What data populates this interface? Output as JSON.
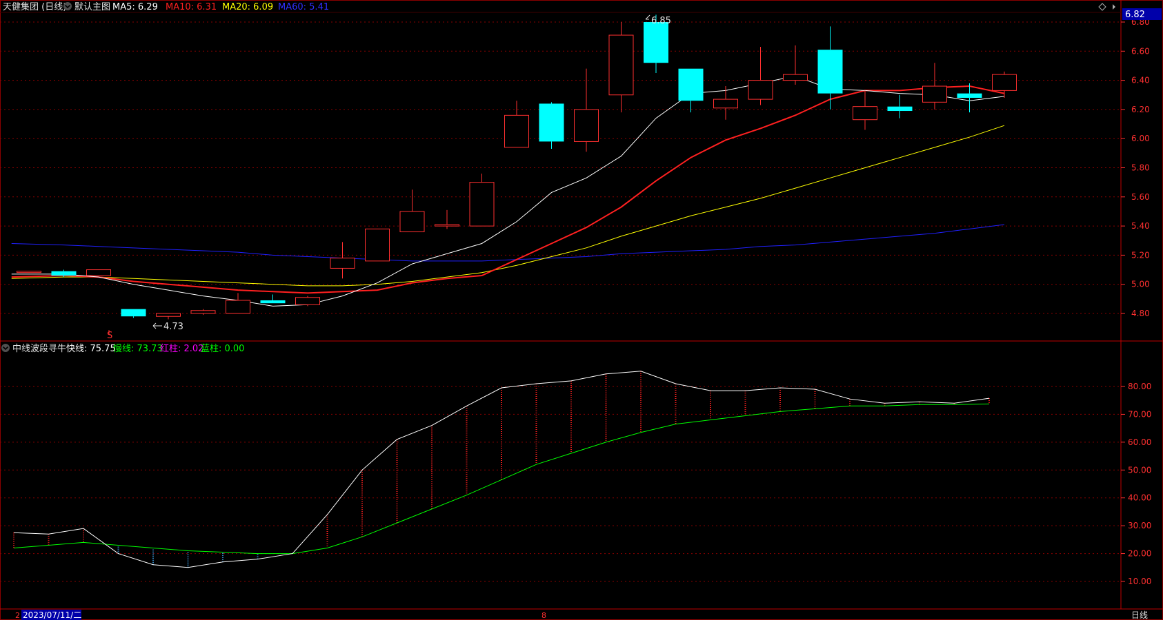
{
  "header": {
    "stock_name": "天健集团 (日线)",
    "main_chart_label": "默认主图",
    "ma_labels": [
      {
        "text": "MA5: 6.29",
        "color": "#ffffff"
      },
      {
        "text": "MA10: 6.31",
        "color": "#ff2020"
      },
      {
        "text": "MA20: 6.09",
        "color": "#ffff00"
      },
      {
        "text": "MA60: 5.41",
        "color": "#2020ff"
      }
    ],
    "current_price_badge": "6.82"
  },
  "indicator_header": {
    "name": "中线波段寻牛",
    "items": [
      {
        "text": "快线: 75.75",
        "color": "#ffffff"
      },
      {
        "text": "慢线: 73.73",
        "color": "#00ff00"
      },
      {
        "text": "红柱: 2.02",
        "color": "#ff00ff"
      },
      {
        "text": "蓝柱: 0.00",
        "color": "#00ff00"
      }
    ]
  },
  "price_axis_ticks": [
    "6.80",
    "6.60",
    "6.40",
    "6.20",
    "6.00",
    "5.80",
    "5.60",
    "5.40",
    "5.20",
    "5.00",
    "4.80"
  ],
  "indicator_axis_ticks": [
    "80.00",
    "70.00",
    "60.00",
    "50.00",
    "40.00",
    "30.00",
    "20.00",
    "10.00"
  ],
  "annotations": {
    "high_label": "6.85",
    "low_label": "4.73",
    "signal_marker": "S"
  },
  "footer": {
    "date": "2023/07/11/二",
    "left_marker": "2",
    "month_marker": "8",
    "period_button": "日线"
  },
  "colors": {
    "up": "#ff3030",
    "down": "#00ffff",
    "ma5": "#ffffff",
    "ma10": "#ff2020",
    "ma20": "#ffff00",
    "ma60": "#2020ff",
    "grid": "#8b0000",
    "axis_text": "#ff3030",
    "fast": "#ffffff",
    "slow": "#00ff00"
  },
  "chart_data": [
    {
      "type": "candlestick",
      "title": "",
      "ylim": [
        4.7,
        6.86
      ],
      "candles": [
        {
          "o": 5.09,
          "h": 5.09,
          "l": 5.09,
          "c": 5.09
        },
        {
          "o": 5.09,
          "h": 5.1,
          "l": 5.05,
          "c": 5.06
        },
        {
          "o": 5.06,
          "h": 5.1,
          "l": 5.06,
          "c": 5.1
        },
        {
          "o": 4.83,
          "h": 4.83,
          "l": 4.77,
          "c": 4.78
        },
        {
          "o": 4.78,
          "h": 4.8,
          "l": 4.76,
          "c": 4.8
        },
        {
          "o": 4.8,
          "h": 4.83,
          "l": 4.79,
          "c": 4.82
        },
        {
          "o": 4.8,
          "h": 4.94,
          "l": 4.8,
          "c": 4.89
        },
        {
          "o": 4.89,
          "h": 4.93,
          "l": 4.87,
          "c": 4.87
        },
        {
          "o": 4.86,
          "h": 4.92,
          "l": 4.85,
          "c": 4.91
        },
        {
          "o": 5.11,
          "h": 5.29,
          "l": 5.04,
          "c": 5.18
        },
        {
          "o": 5.16,
          "h": 5.38,
          "l": 5.16,
          "c": 5.38
        },
        {
          "o": 5.36,
          "h": 5.65,
          "l": 5.36,
          "c": 5.5
        },
        {
          "o": 5.4,
          "h": 5.51,
          "l": 5.38,
          "c": 5.41
        },
        {
          "o": 5.4,
          "h": 5.76,
          "l": 5.4,
          "c": 5.7
        },
        {
          "o": 5.94,
          "h": 6.26,
          "l": 5.94,
          "c": 6.16
        },
        {
          "o": 6.24,
          "h": 6.25,
          "l": 5.93,
          "c": 5.98
        },
        {
          "o": 5.98,
          "h": 6.48,
          "l": 5.91,
          "c": 6.2
        },
        {
          "o": 6.3,
          "h": 6.8,
          "l": 6.18,
          "c": 6.71
        },
        {
          "o": 6.8,
          "h": 6.85,
          "l": 6.45,
          "c": 6.52
        },
        {
          "o": 6.48,
          "h": 6.48,
          "l": 6.18,
          "c": 6.26
        },
        {
          "o": 6.21,
          "h": 6.36,
          "l": 6.13,
          "c": 6.27
        },
        {
          "o": 6.27,
          "h": 6.63,
          "l": 6.23,
          "c": 6.4
        },
        {
          "o": 6.4,
          "h": 6.64,
          "l": 6.37,
          "c": 6.44
        },
        {
          "o": 6.61,
          "h": 6.77,
          "l": 6.2,
          "c": 6.31
        },
        {
          "o": 6.13,
          "h": 6.33,
          "l": 6.06,
          "c": 6.22
        },
        {
          "o": 6.22,
          "h": 6.3,
          "l": 6.14,
          "c": 6.19
        },
        {
          "o": 6.25,
          "h": 6.52,
          "l": 6.2,
          "c": 6.36
        },
        {
          "o": 6.31,
          "h": 6.38,
          "l": 6.18,
          "c": 6.28
        },
        {
          "o": 6.33,
          "h": 6.46,
          "l": 6.28,
          "c": 6.44
        }
      ],
      "ma5": [
        5.07,
        5.07,
        5.05,
        5.0,
        4.96,
        4.92,
        4.89,
        4.85,
        4.86,
        4.92,
        5.01,
        5.14,
        5.21,
        5.28,
        5.43,
        5.63,
        5.73,
        5.88,
        6.14,
        6.31,
        6.33,
        6.38,
        6.43,
        6.34,
        6.33,
        6.31,
        6.3,
        6.26,
        6.29
      ],
      "ma10": [
        5.05,
        5.06,
        5.05,
        5.02,
        5.0,
        4.98,
        4.96,
        4.95,
        4.94,
        4.95,
        4.96,
        5.01,
        5.04,
        5.06,
        5.17,
        5.28,
        5.39,
        5.53,
        5.71,
        5.87,
        5.99,
        6.07,
        6.16,
        6.27,
        6.33,
        6.33,
        6.35,
        6.36,
        6.31
      ],
      "ma20": [
        5.04,
        5.05,
        5.05,
        5.04,
        5.03,
        5.02,
        5.01,
        5.0,
        4.99,
        4.99,
        5.0,
        5.02,
        5.05,
        5.08,
        5.13,
        5.19,
        5.25,
        5.33,
        5.4,
        5.47,
        5.53,
        5.59,
        5.66,
        5.73,
        5.8,
        5.87,
        5.94,
        6.01,
        6.09
      ],
      "ma60": [
        5.28,
        5.27,
        5.26,
        5.25,
        5.24,
        5.23,
        5.22,
        5.2,
        5.19,
        5.18,
        5.17,
        5.16,
        5.16,
        5.16,
        5.17,
        5.18,
        5.19,
        5.21,
        5.22,
        5.23,
        5.24,
        5.26,
        5.27,
        5.29,
        5.31,
        5.33,
        5.35,
        5.38,
        5.41
      ]
    },
    {
      "type": "line",
      "title": "",
      "ylim": [
        0,
        90
      ],
      "series": [
        {
          "name": "快线",
          "values": [
            27.5,
            27.0,
            29.0,
            20.0,
            16.0,
            15.0,
            17.0,
            18.0,
            20.0,
            34.0,
            50.0,
            61.0,
            66.0,
            73.0,
            79.5,
            81.0,
            82.0,
            84.5,
            85.5,
            81.0,
            78.5,
            78.5,
            79.5,
            79.0,
            75.5,
            74.0,
            74.5,
            74.0,
            75.75
          ]
        },
        {
          "name": "慢线",
          "values": [
            22.0,
            23.0,
            24.0,
            23.0,
            22.0,
            21.0,
            20.5,
            20.0,
            20.0,
            22.0,
            26.0,
            31.0,
            36.0,
            41.0,
            46.5,
            52.0,
            56.0,
            60.0,
            63.5,
            66.5,
            68.0,
            69.5,
            71.0,
            72.0,
            73.0,
            73.0,
            73.5,
            73.5,
            73.73
          ]
        }
      ]
    }
  ]
}
